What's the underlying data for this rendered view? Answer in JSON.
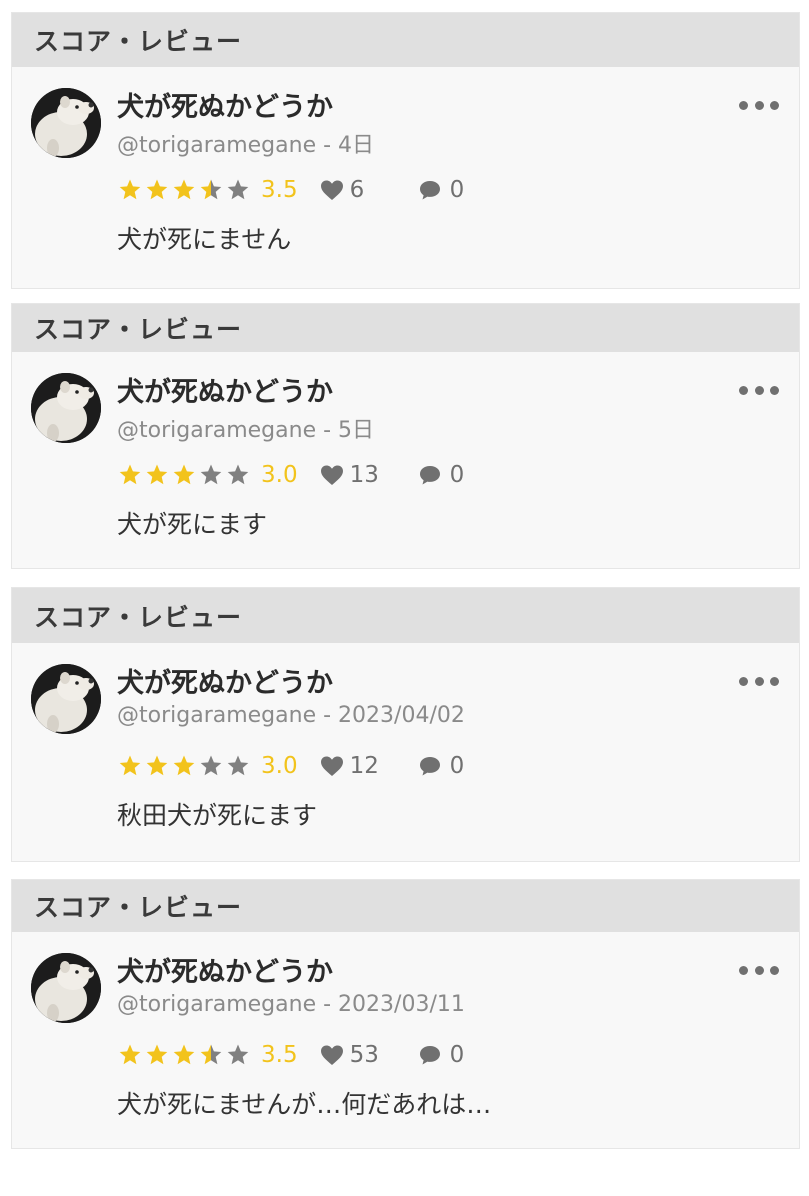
{
  "colors": {
    "star_filled": "#f2c31c",
    "star_empty": "#808080",
    "header_bg": "#e0e0e0",
    "card_bg": "#f8f8f8",
    "meta_text": "#8a8a8a"
  },
  "reviews": [
    {
      "section_label": "スコア・レビュー",
      "title": "犬が死ぬかどうか",
      "user": "@torigaramegane",
      "separator": " - ",
      "time": "4日",
      "rating": 3.5,
      "score_text": "3.5",
      "likes": "6",
      "comments": "0",
      "text": "犬が死にません"
    },
    {
      "section_label": "スコア・レビュー",
      "title": "犬が死ぬかどうか",
      "user": "@torigaramegane",
      "separator": " - ",
      "time": "5日",
      "rating": 3.0,
      "score_text": "3.0",
      "likes": "13",
      "comments": "0",
      "text": "犬が死にます"
    },
    {
      "section_label": "スコア・レビュー",
      "title": "犬が死ぬかどうか",
      "user": "@torigaramegane",
      "separator": " - ",
      "time": "2023/04/02",
      "rating": 3.0,
      "score_text": "3.0",
      "likes": "12",
      "comments": "0",
      "text": "秋田犬が死にます"
    },
    {
      "section_label": "スコア・レビュー",
      "title": "犬が死ぬかどうか",
      "user": "@torigaramegane",
      "separator": " - ",
      "time": "2023/03/11",
      "rating": 3.5,
      "score_text": "3.5",
      "likes": "53",
      "comments": "0",
      "text": "犬が死にませんが…何だあれは…"
    }
  ]
}
